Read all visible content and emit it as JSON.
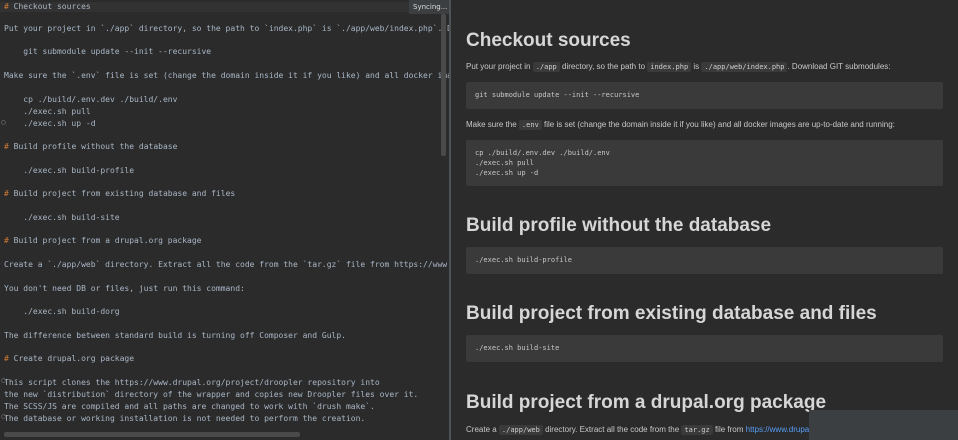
{
  "editor": {
    "syncing_label": "Syncing...",
    "lines": [
      {
        "kind": "heading",
        "hash": "#",
        "text": " Checkout sources"
      },
      {
        "kind": "text",
        "text": "Put your project in `./app` directory, so the path to `index.php` is `./app/web/index.php`. Download GIT submodules:"
      },
      {
        "kind": "code",
        "text": "    git submodule update --init --recursive"
      },
      {
        "kind": "text",
        "text": "Make sure the `.env` file is set (change the domain inside it if you like) and all docker images are up-to-date and running:"
      },
      {
        "kind": "code",
        "text": "    cp ./build/.env.dev ./build/.env"
      },
      {
        "kind": "code",
        "text": "    ./exec.sh pull"
      },
      {
        "kind": "code",
        "text": "    ./exec.sh up -d"
      },
      {
        "kind": "heading",
        "hash": "#",
        "text": " Build profile without the database"
      },
      {
        "kind": "code",
        "text": "    ./exec.sh build-profile"
      },
      {
        "kind": "heading",
        "hash": "#",
        "text": " Build project from existing database and files"
      },
      {
        "kind": "code",
        "text": "    ./exec.sh build-site"
      },
      {
        "kind": "heading",
        "hash": "#",
        "text": " Build project from a drupal.org package"
      },
      {
        "kind": "text",
        "text": "Create a `./app/web` directory. Extract all the code from the `tar.gz` file from https://www.drupal.org/project/droopler"
      },
      {
        "kind": "text",
        "text": "You don't need DB or files, just run this command:"
      },
      {
        "kind": "code",
        "text": "    ./exec.sh build-dorg"
      },
      {
        "kind": "text",
        "text": "The difference between standard build is turning off Composer and Gulp."
      },
      {
        "kind": "heading",
        "hash": "#",
        "text": " Create drupal.org package"
      },
      {
        "kind": "text",
        "text": "This script clones the https://www.drupal.org/project/droopler repository into"
      },
      {
        "kind": "text",
        "text": "the new `distribution` directory of the wrapper and copies new Droopler files over it."
      },
      {
        "kind": "text",
        "text": "The SCSS/JS are compiled and all paths are changed to work with `drush make`."
      },
      {
        "kind": "text",
        "text": "The database or working installation is not needed to perform the creation."
      }
    ]
  },
  "preview": {
    "h_checkout": "Checkout sources",
    "p1": {
      "a": "Put your project in ",
      "c1": "./app",
      "b": " directory, so the path to ",
      "c2": "index.php",
      "c": " is ",
      "c3": "./app/web/index.php",
      "d": ". Download GIT submodules:"
    },
    "code1": "git submodule update --init --recursive",
    "p2": {
      "a": "Make sure the ",
      "c1": ".env",
      "b": " file is set (change the domain inside it if you like) and all docker images are up-to-date and running:"
    },
    "code2": "cp ./build/.env.dev ./build/.env\n./exec.sh pull\n./exec.sh up -d",
    "h_profile": "Build profile without the database",
    "code3": "./exec.sh build-profile",
    "h_existing": "Build project from existing database and files",
    "code4": "./exec.sh build-site",
    "h_dorg": "Build project from a drupal.org package",
    "p3": {
      "a": "Create a ",
      "c1": "./app/web",
      "b": " directory. Extract all the code from the ",
      "c2": "tar.gz",
      "c": " file from ",
      "link": "https://www.drupal.org"
    }
  }
}
